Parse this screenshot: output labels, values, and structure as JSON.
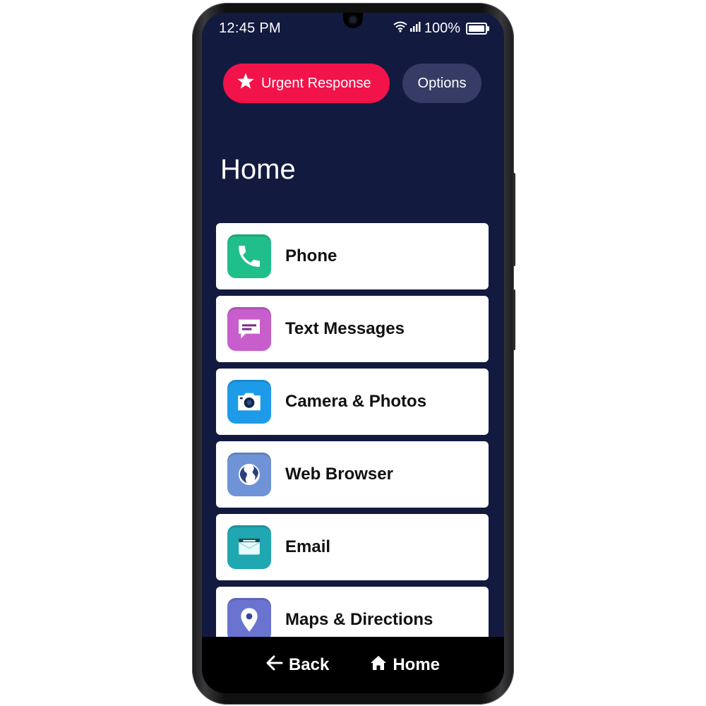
{
  "status_bar": {
    "time": "12:45 PM",
    "battery": "100%"
  },
  "header": {
    "urgent_label": "Urgent Response",
    "options_label": "Options"
  },
  "page": {
    "title": "Home"
  },
  "apps": [
    {
      "label": "Phone",
      "icon": "phone-icon",
      "color": "#1fbe8a"
    },
    {
      "label": "Text Messages",
      "icon": "message-bubble-icon",
      "color": "#c75ecb"
    },
    {
      "label": "Camera & Photos",
      "icon": "camera-icon",
      "color": "#1e9be8"
    },
    {
      "label": "Web Browser",
      "icon": "globe-icon",
      "color": "#6f93d6"
    },
    {
      "label": "Email",
      "icon": "envelope-icon",
      "color": "#1fa7b2"
    },
    {
      "label": "Maps & Directions",
      "icon": "map-pin-icon",
      "color": "#6a74d0"
    }
  ],
  "nav": {
    "back_label": "Back",
    "home_label": "Home"
  },
  "colors": {
    "urgent": "#f2134a",
    "background": "#131a3f",
    "options": "#363c66"
  }
}
